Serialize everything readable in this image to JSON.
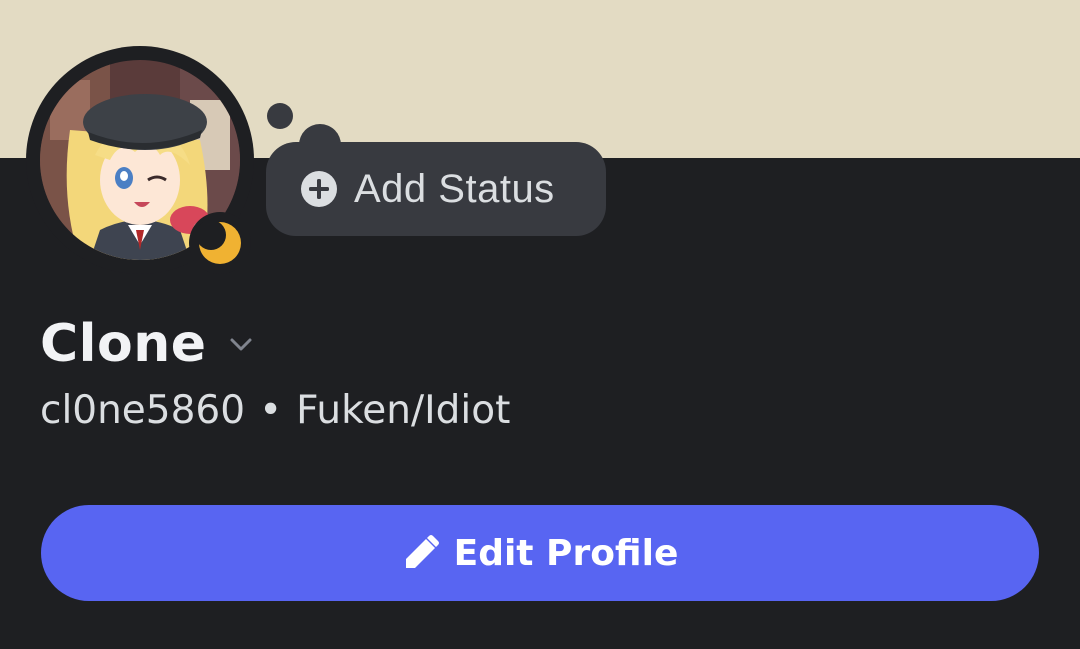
{
  "profile": {
    "display_name": "Clone",
    "username": "cl0ne5860",
    "separator": "•",
    "pronouns": "Fuken/Idiot",
    "online_status": "idle",
    "avatar": "anime-girl-avatar"
  },
  "status_bubble": {
    "label": "Add Status",
    "icon": "plus-circle-icon"
  },
  "actions": {
    "edit_profile_label": "Edit Profile",
    "edit_icon": "pencil-icon"
  },
  "colors": {
    "banner": "#e3dbc3",
    "background": "#1e1f22",
    "bubble": "#383a40",
    "accent": "#5865f2",
    "idle": "#f0b232"
  }
}
